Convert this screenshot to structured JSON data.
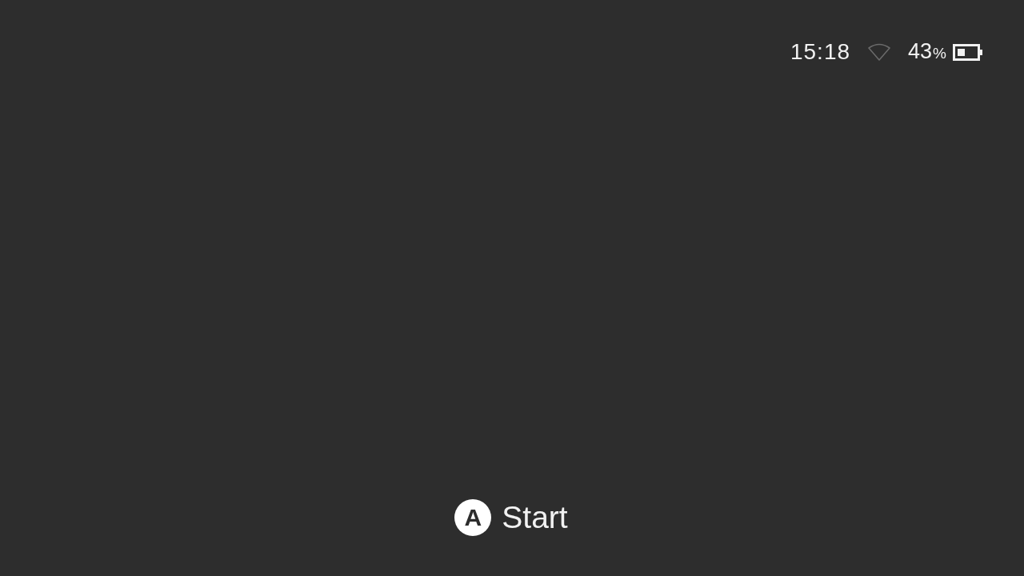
{
  "status_bar": {
    "time": "15:18",
    "wifi": {
      "connected": false
    },
    "battery": {
      "percent": "43",
      "unit": "%"
    }
  },
  "prompt": {
    "glyph": "A",
    "label": "Start"
  }
}
